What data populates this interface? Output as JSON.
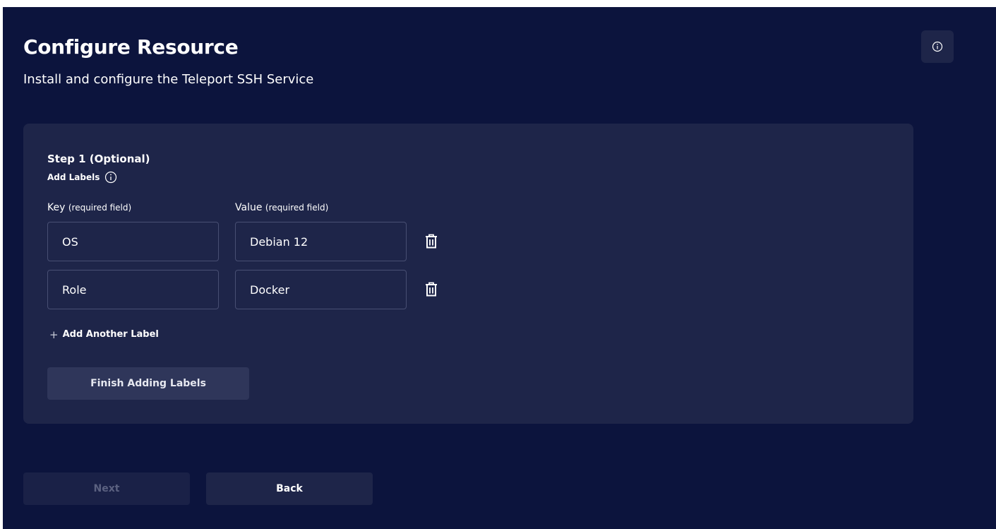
{
  "header": {
    "title": "Configure Resource",
    "subtitle": "Install and configure the Teleport SSH Service"
  },
  "info_button": {
    "icon": "info-circle-icon"
  },
  "step": {
    "title": "Step 1 (Optional)",
    "add_labels": "Add Labels",
    "add_labels_icon": "info-circle-icon",
    "key_label": "Key",
    "key_hint": "(required field)",
    "value_label": "Value",
    "value_hint": "(required field)",
    "labels": [
      {
        "key": "OS",
        "value": "Debian 12"
      },
      {
        "key": "Role",
        "value": "Docker"
      }
    ],
    "delete_icon": "trash-icon",
    "add_another": "Add Another Label",
    "finish": "Finish Adding Labels"
  },
  "footer": {
    "next": "Next",
    "back": "Back"
  },
  "colors": {
    "background": "#0c143d",
    "card": "#1e2549",
    "input_border": "#484f73",
    "button": "#2f365a",
    "disabled_text": "#5b6180"
  }
}
